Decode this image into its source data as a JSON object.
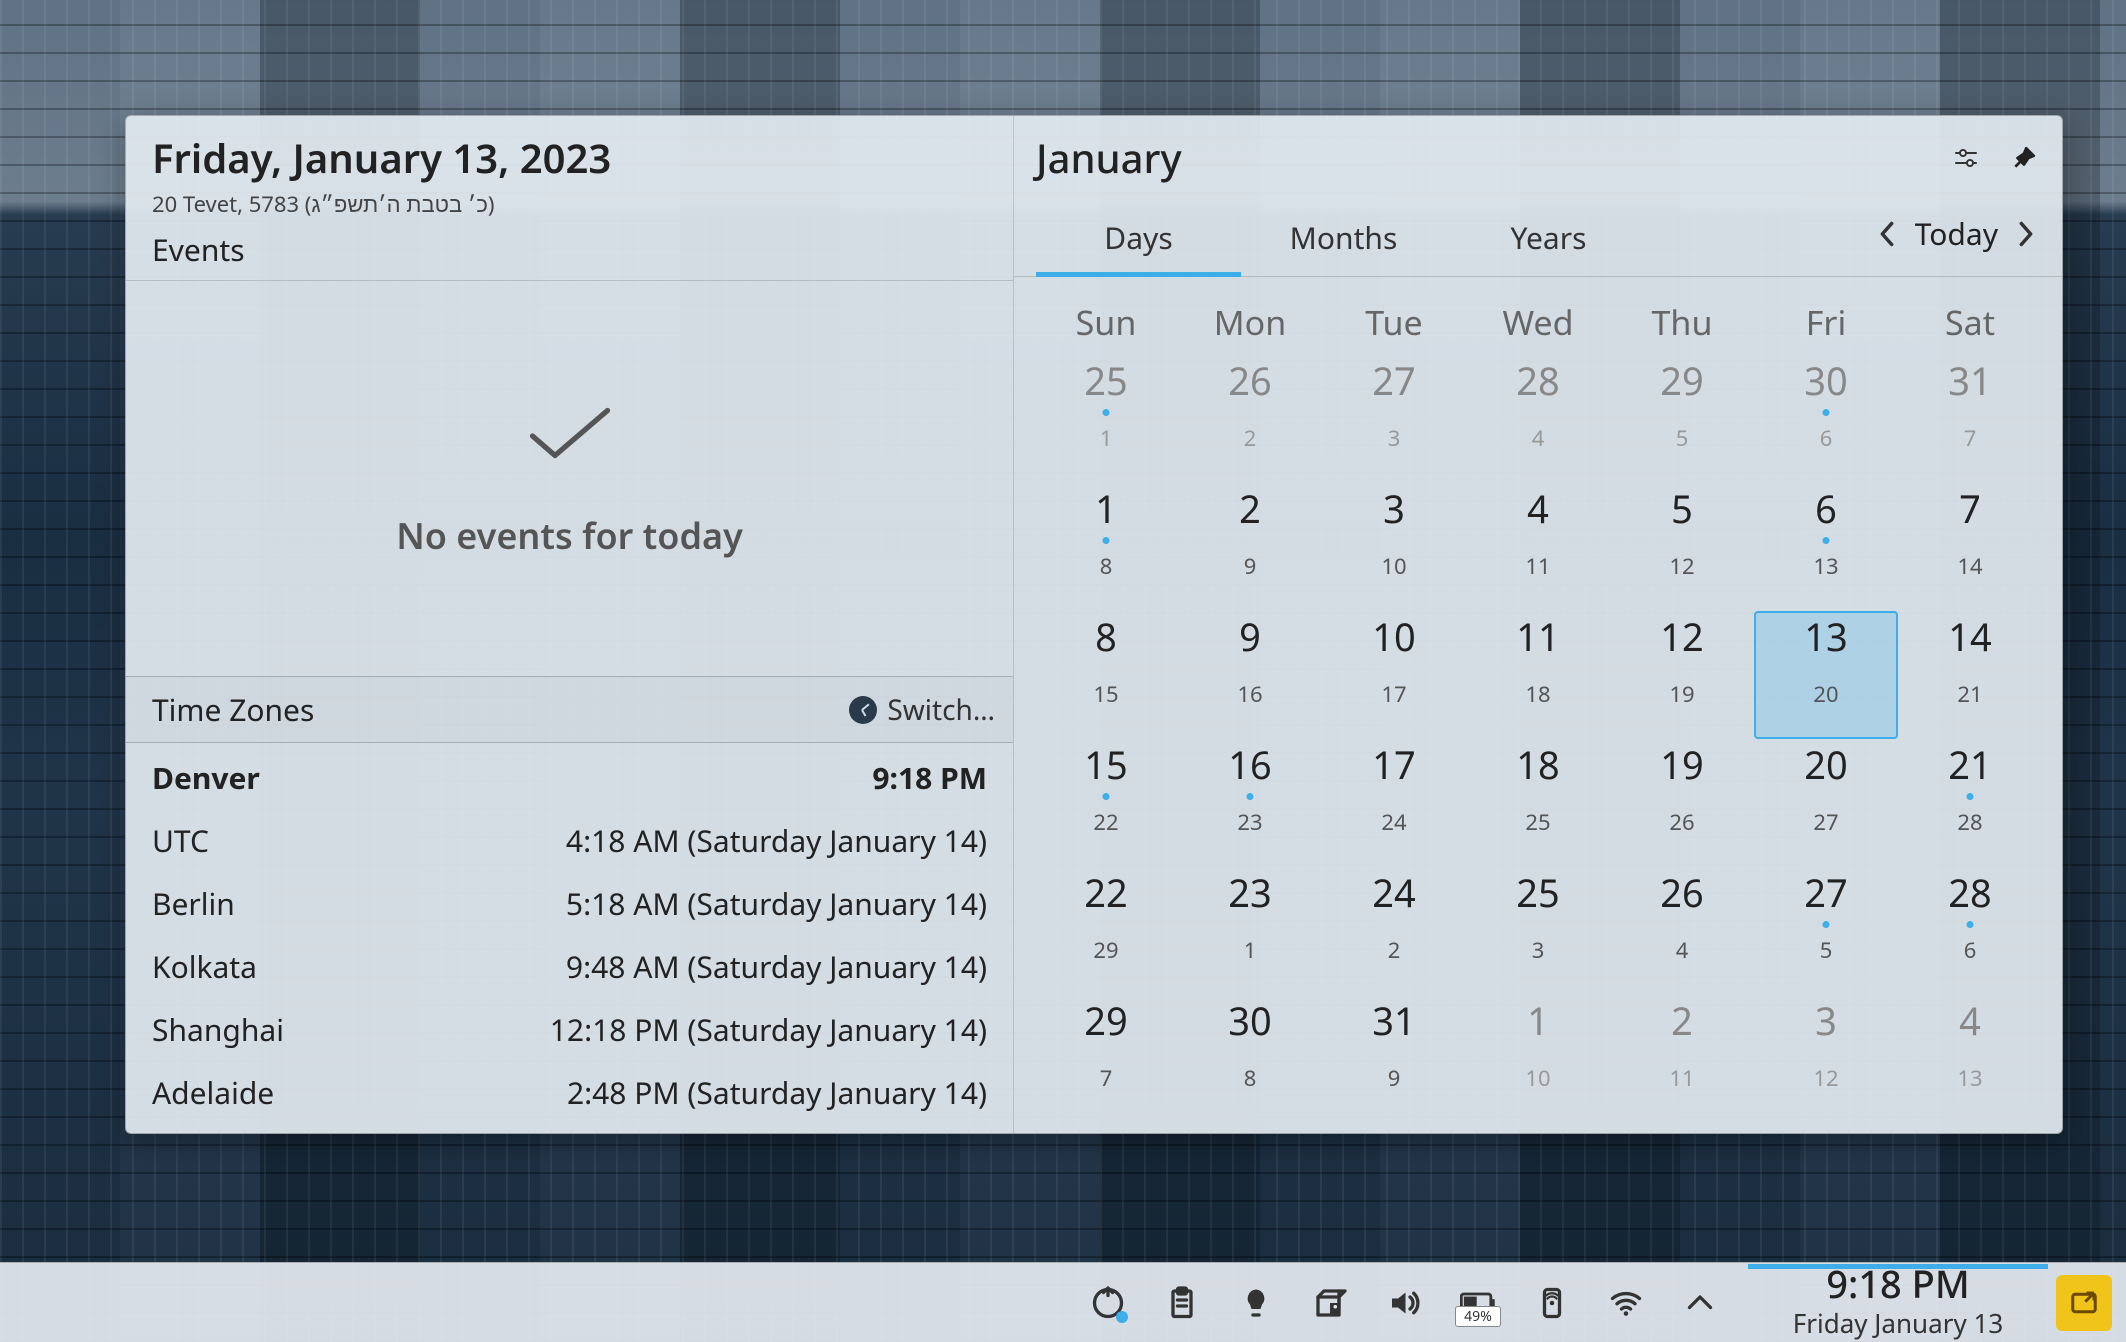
{
  "left": {
    "dateTitle": "Friday, January 13, 2023",
    "altDate": "20 Tevet, 5783 (כ׳ בטבת ה׳תשפ״ג)",
    "eventsHeading": "Events",
    "noEventsText": "No events for today"
  },
  "timezones": {
    "heading": "Time Zones",
    "switchLabel": "Switch…",
    "rows": [
      {
        "city": "Denver",
        "time": "9:18 PM",
        "primary": true
      },
      {
        "city": "UTC",
        "time": "4:18 AM (Saturday January 14)",
        "primary": false
      },
      {
        "city": "Berlin",
        "time": "5:18 AM (Saturday January 14)",
        "primary": false
      },
      {
        "city": "Kolkata",
        "time": "9:48 AM (Saturday January 14)",
        "primary": false
      },
      {
        "city": "Shanghai",
        "time": "12:18 PM (Saturday January 14)",
        "primary": false
      },
      {
        "city": "Adelaide",
        "time": "2:48 PM (Saturday January 14)",
        "primary": false
      }
    ]
  },
  "calendar": {
    "monthTitle": "January",
    "tabs": {
      "days": "Days",
      "months": "Months",
      "years": "Years",
      "active": "days"
    },
    "todayLabel": "Today",
    "dow": [
      "Sun",
      "Mon",
      "Tue",
      "Wed",
      "Thu",
      "Fri",
      "Sat"
    ],
    "weeks": [
      [
        {
          "d": "25",
          "sub": "1",
          "outside": true,
          "dot": true
        },
        {
          "d": "26",
          "sub": "2",
          "outside": true,
          "dot": false
        },
        {
          "d": "27",
          "sub": "3",
          "outside": true,
          "dot": false
        },
        {
          "d": "28",
          "sub": "4",
          "outside": true,
          "dot": false
        },
        {
          "d": "29",
          "sub": "5",
          "outside": true,
          "dot": false
        },
        {
          "d": "30",
          "sub": "6",
          "outside": true,
          "dot": true
        },
        {
          "d": "31",
          "sub": "7",
          "outside": true,
          "dot": false
        }
      ],
      [
        {
          "d": "1",
          "sub": "8",
          "outside": false,
          "dot": true
        },
        {
          "d": "2",
          "sub": "9",
          "outside": false,
          "dot": false
        },
        {
          "d": "3",
          "sub": "10",
          "outside": false,
          "dot": false
        },
        {
          "d": "4",
          "sub": "11",
          "outside": false,
          "dot": false
        },
        {
          "d": "5",
          "sub": "12",
          "outside": false,
          "dot": false
        },
        {
          "d": "6",
          "sub": "13",
          "outside": false,
          "dot": true
        },
        {
          "d": "7",
          "sub": "14",
          "outside": false,
          "dot": false
        }
      ],
      [
        {
          "d": "8",
          "sub": "15",
          "outside": false,
          "dot": false
        },
        {
          "d": "9",
          "sub": "16",
          "outside": false,
          "dot": false
        },
        {
          "d": "10",
          "sub": "17",
          "outside": false,
          "dot": false
        },
        {
          "d": "11",
          "sub": "18",
          "outside": false,
          "dot": false
        },
        {
          "d": "12",
          "sub": "19",
          "outside": false,
          "dot": false
        },
        {
          "d": "13",
          "sub": "20",
          "outside": false,
          "dot": false,
          "selected": true
        },
        {
          "d": "14",
          "sub": "21",
          "outside": false,
          "dot": false
        }
      ],
      [
        {
          "d": "15",
          "sub": "22",
          "outside": false,
          "dot": true
        },
        {
          "d": "16",
          "sub": "23",
          "outside": false,
          "dot": true
        },
        {
          "d": "17",
          "sub": "24",
          "outside": false,
          "dot": false
        },
        {
          "d": "18",
          "sub": "25",
          "outside": false,
          "dot": false
        },
        {
          "d": "19",
          "sub": "26",
          "outside": false,
          "dot": false
        },
        {
          "d": "20",
          "sub": "27",
          "outside": false,
          "dot": false
        },
        {
          "d": "21",
          "sub": "28",
          "outside": false,
          "dot": true
        }
      ],
      [
        {
          "d": "22",
          "sub": "29",
          "outside": false,
          "dot": false
        },
        {
          "d": "23",
          "sub": "1",
          "outside": false,
          "dot": false
        },
        {
          "d": "24",
          "sub": "2",
          "outside": false,
          "dot": false
        },
        {
          "d": "25",
          "sub": "3",
          "outside": false,
          "dot": false
        },
        {
          "d": "26",
          "sub": "4",
          "outside": false,
          "dot": false
        },
        {
          "d": "27",
          "sub": "5",
          "outside": false,
          "dot": true
        },
        {
          "d": "28",
          "sub": "6",
          "outside": false,
          "dot": true
        }
      ],
      [
        {
          "d": "29",
          "sub": "7",
          "outside": false,
          "dot": false
        },
        {
          "d": "30",
          "sub": "8",
          "outside": false,
          "dot": false
        },
        {
          "d": "31",
          "sub": "9",
          "outside": false,
          "dot": false
        },
        {
          "d": "1",
          "sub": "10",
          "outside": true,
          "dot": false
        },
        {
          "d": "2",
          "sub": "11",
          "outside": true,
          "dot": false
        },
        {
          "d": "3",
          "sub": "12",
          "outside": true,
          "dot": false
        },
        {
          "d": "4",
          "sub": "13",
          "outside": true,
          "dot": false
        }
      ]
    ]
  },
  "taskbar": {
    "batteryPercent": "49%",
    "clockTime": "9:18 PM",
    "clockDate": "Friday January 13"
  }
}
